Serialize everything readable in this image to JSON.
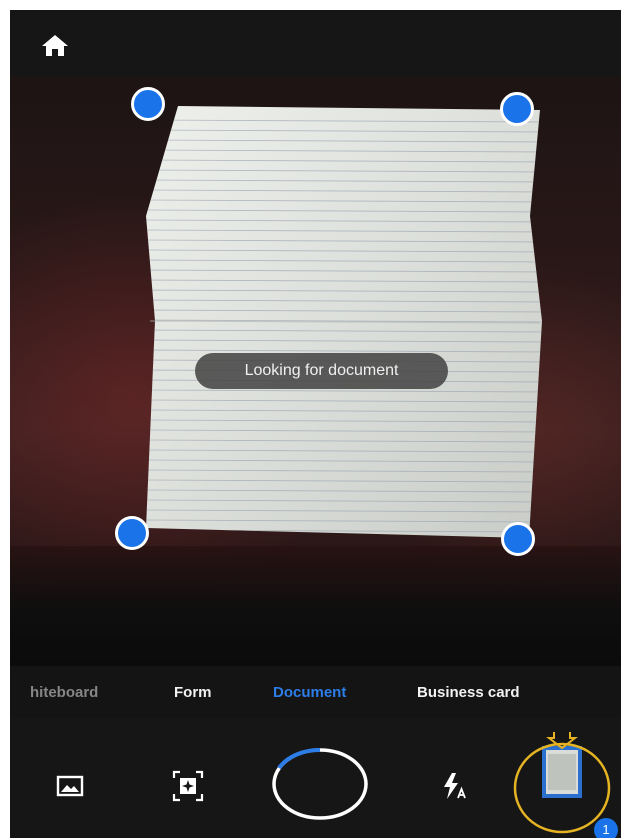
{
  "app": {
    "accent_color": "#1a73e8",
    "highlight_color": "#e6b422"
  },
  "topbar": {
    "home_icon": "home-icon"
  },
  "viewfinder": {
    "status_text": "Looking for document"
  },
  "modes": {
    "items": [
      "hiteboard",
      "Form",
      "Document",
      "Business card"
    ],
    "selected": "Document"
  },
  "controls": {
    "gallery_icon": "gallery-icon",
    "autocapture_icon": "auto-capture-icon",
    "shutter_icon": "shutter-progress-ring",
    "flash_icon": "flash-auto-icon",
    "thumbnail_icon": "captured-page-thumbnail",
    "page_count": "1"
  }
}
